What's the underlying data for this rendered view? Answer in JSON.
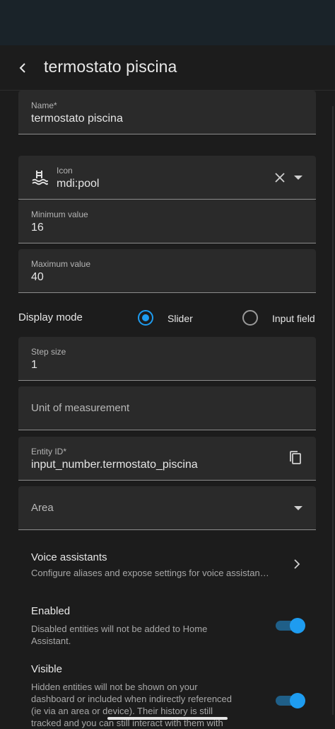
{
  "header": {
    "title": "termostato piscina"
  },
  "fields": {
    "name": {
      "label": "Name*",
      "value": "termostato piscina"
    },
    "icon": {
      "label": "Icon",
      "value": "mdi:pool"
    },
    "min": {
      "label": "Minimum value",
      "value": "16"
    },
    "max": {
      "label": "Maximum value",
      "value": "40"
    },
    "step": {
      "label": "Step size",
      "value": "1"
    },
    "unit": {
      "placeholder": "Unit of measurement"
    },
    "entity": {
      "label": "Entity ID*",
      "value": "input_number.termostato_piscina"
    },
    "area": {
      "placeholder": "Area"
    }
  },
  "display_mode": {
    "label": "Display mode",
    "options": [
      {
        "label": "Slider",
        "selected": true
      },
      {
        "label": "Input field",
        "selected": false
      }
    ]
  },
  "voice": {
    "title": "Voice assistants",
    "description": "Configure aliases and expose settings for voice assistan…"
  },
  "enabled": {
    "title": "Enabled",
    "description_line1": "Disabled entities will not be added to Home",
    "description_line2": "Assistant.",
    "on": true
  },
  "visible": {
    "title": "Visible",
    "description_line1": "Hidden entities will not be shown on your",
    "description_line2": "dashboard or included when indirectly referenced",
    "description_line3": "(ie via an area or device). Their history is still",
    "description_line4": "tracked and you can still interact with them with",
    "on": true
  },
  "colors": {
    "accent": "#1e9cf0",
    "background": "#1c1c1c",
    "field": "#2a2a2a"
  }
}
